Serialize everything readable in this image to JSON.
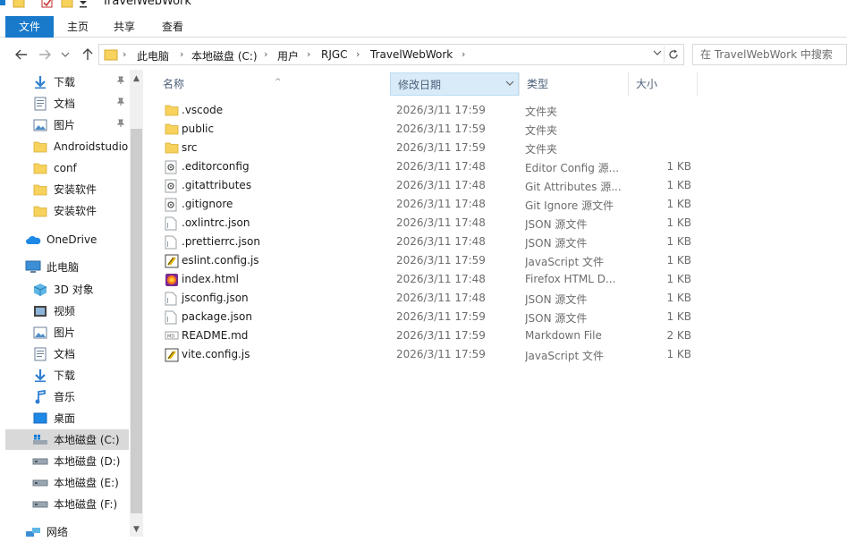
{
  "window": {
    "title": "TravelWebWork"
  },
  "ribbon": {
    "tabs": [
      "文件",
      "主页",
      "共享",
      "查看"
    ]
  },
  "address": {
    "crumbs": [
      "此电脑",
      "本地磁盘 (C:)",
      "用户",
      "RJGC",
      "TravelWebWork"
    ],
    "search_placeholder": "在 TravelWebWork 中搜索"
  },
  "sidebar": {
    "items": [
      {
        "label": "下载",
        "icon": "download-arrow-icon",
        "pinned": true
      },
      {
        "label": "文档",
        "icon": "document-icon",
        "pinned": true
      },
      {
        "label": "图片",
        "icon": "picture-icon",
        "pinned": true
      },
      {
        "label": "Androidstudio",
        "icon": "folder-icon"
      },
      {
        "label": "conf",
        "icon": "folder-icon"
      },
      {
        "label": "安装软件",
        "icon": "folder-icon"
      },
      {
        "label": "安装软件",
        "icon": "folder-icon"
      },
      {
        "label": "OneDrive",
        "icon": "onedrive-cloud-icon"
      },
      {
        "label": "此电脑",
        "icon": "computer-icon"
      },
      {
        "label": "3D 对象",
        "icon": "3d-objects-icon"
      },
      {
        "label": "视频",
        "icon": "video-icon"
      },
      {
        "label": "图片",
        "icon": "picture-icon"
      },
      {
        "label": "文档",
        "icon": "document-icon"
      },
      {
        "label": "下载",
        "icon": "download-arrow-icon"
      },
      {
        "label": "音乐",
        "icon": "music-note-icon"
      },
      {
        "label": "桌面",
        "icon": "desktop-icon"
      },
      {
        "label": "本地磁盘 (C:)",
        "icon": "windows-drive-icon",
        "selected": true
      },
      {
        "label": "本地磁盘 (D:)",
        "icon": "drive-icon"
      },
      {
        "label": "本地磁盘 (E:)",
        "icon": "drive-icon"
      },
      {
        "label": "本地磁盘 (F:)",
        "icon": "drive-icon"
      },
      {
        "label": "网络",
        "icon": "network-icon"
      }
    ]
  },
  "columns": {
    "name": "名称",
    "date": "修改日期",
    "type": "类型",
    "size": "大小"
  },
  "files": [
    {
      "name": ".vscode",
      "date": "2026/3/11 17:59",
      "type": "文件夹",
      "size": "",
      "icon": "folder-icon"
    },
    {
      "name": "public",
      "date": "2026/3/11 17:59",
      "type": "文件夹",
      "size": "",
      "icon": "folder-icon"
    },
    {
      "name": "src",
      "date": "2026/3/11 17:59",
      "type": "文件夹",
      "size": "",
      "icon": "folder-icon"
    },
    {
      "name": ".editorconfig",
      "date": "2026/3/11 17:48",
      "type": "Editor Config 源...",
      "size": "1 KB",
      "icon": "config-file-icon"
    },
    {
      "name": ".gitattributes",
      "date": "2026/3/11 17:48",
      "type": "Git Attributes 源...",
      "size": "1 KB",
      "icon": "config-file-icon"
    },
    {
      "name": ".gitignore",
      "date": "2026/3/11 17:48",
      "type": "Git Ignore 源文件",
      "size": "1 KB",
      "icon": "config-file-icon"
    },
    {
      "name": ".oxlintrc.json",
      "date": "2026/3/11 17:48",
      "type": "JSON 源文件",
      "size": "1 KB",
      "icon": "text-file-icon"
    },
    {
      "name": ".prettierrc.json",
      "date": "2026/3/11 17:48",
      "type": "JSON 源文件",
      "size": "1 KB",
      "icon": "text-file-icon"
    },
    {
      "name": "eslint.config.js",
      "date": "2026/3/11 17:59",
      "type": "JavaScript 文件",
      "size": "1 KB",
      "icon": "javascript-file-icon"
    },
    {
      "name": "index.html",
      "date": "2026/3/11 17:48",
      "type": "Firefox HTML D...",
      "size": "1 KB",
      "icon": "firefox-html-icon"
    },
    {
      "name": "jsconfig.json",
      "date": "2026/3/11 17:48",
      "type": "JSON 源文件",
      "size": "1 KB",
      "icon": "text-file-icon"
    },
    {
      "name": "package.json",
      "date": "2026/3/11 17:59",
      "type": "JSON 源文件",
      "size": "1 KB",
      "icon": "text-file-icon"
    },
    {
      "name": "README.md",
      "date": "2026/3/11 17:59",
      "type": "Markdown File",
      "size": "2 KB",
      "icon": "markdown-file-icon"
    },
    {
      "name": "vite.config.js",
      "date": "2026/3/11 17:59",
      "type": "JavaScript 文件",
      "size": "1 KB",
      "icon": "javascript-file-icon"
    }
  ],
  "colors": {
    "accent": "#1979ca",
    "folder": "#f7d25c",
    "sort_header": "#d9ebf9",
    "selected_nav": "#d9d9d9"
  }
}
